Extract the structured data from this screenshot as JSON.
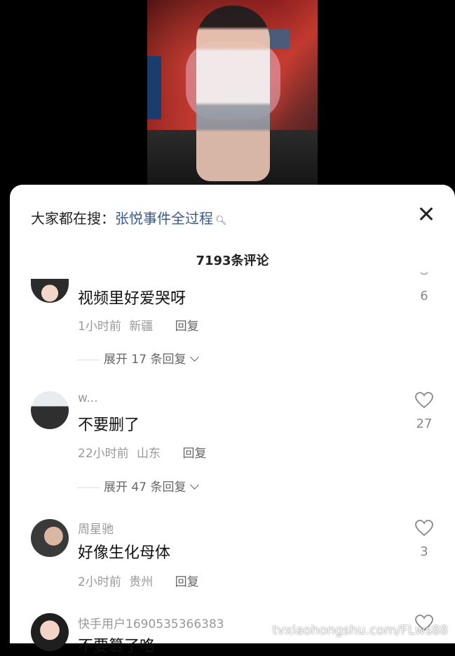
{
  "search_hint": {
    "prefix": "大家都在搜：",
    "keyword": "张悦事件全过程"
  },
  "comment_count": "7193条评论",
  "comments": [
    {
      "username": "",
      "text": "视频里好爱哭呀",
      "time": "1小时前",
      "location": "新疆",
      "reply": "回复",
      "expand": "展开 17 条回复",
      "likes": "6"
    },
    {
      "username": "w...",
      "text": "不要删了",
      "time": "22小时前",
      "location": "山东",
      "reply": "回复",
      "expand": "展开 47 条回复",
      "likes": "27"
    },
    {
      "username": "周星驰",
      "text": "好像生化母体",
      "time": "2小时前",
      "location": "贵州",
      "reply": "回复",
      "likes": "3"
    },
    {
      "username": "快手用户1690535366383",
      "text": "不要篡了咯"
    }
  ],
  "watermark": "tvxiaohongshu.com/FLws88"
}
